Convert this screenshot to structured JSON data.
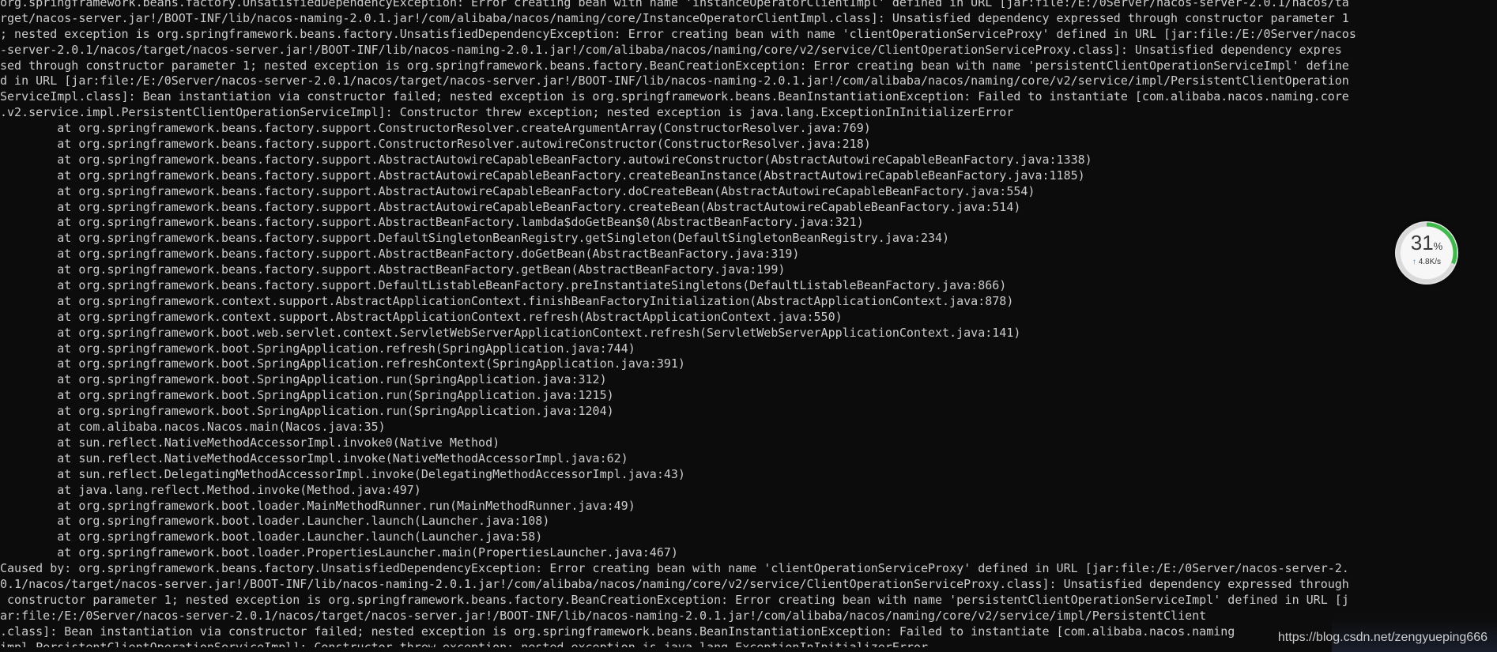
{
  "console": {
    "lines": [
      "org.springframework.beans.factory.UnsatisfiedDependencyException: Error creating bean with name 'instanceOperatorClientImpl' defined in URL [jar:file:/E:/0Server/nacos-server-2.0.1/nacos/ta",
      "rget/nacos-server.jar!/BOOT-INF/lib/nacos-naming-2.0.1.jar!/com/alibaba/nacos/naming/core/InstanceOperatorClientImpl.class]: Unsatisfied dependency expressed through constructor parameter 1",
      "; nested exception is org.springframework.beans.factory.UnsatisfiedDependencyException: Error creating bean with name 'clientOperationServiceProxy' defined in URL [jar:file:/E:/0Server/nacos",
      "-server-2.0.1/nacos/target/nacos-server.jar!/BOOT-INF/lib/nacos-naming-2.0.1.jar!/com/alibaba/nacos/naming/core/v2/service/ClientOperationServiceProxy.class]: Unsatisfied dependency expres",
      "sed through constructor parameter 1; nested exception is org.springframework.beans.factory.BeanCreationException: Error creating bean with name 'persistentClientOperationServiceImpl' define",
      "d in URL [jar:file:/E:/0Server/nacos-server-2.0.1/nacos/target/nacos-server.jar!/BOOT-INF/lib/nacos-naming-2.0.1.jar!/com/alibaba/nacos/naming/core/v2/service/impl/PersistentClientOperation",
      "ServiceImpl.class]: Bean instantiation via constructor failed; nested exception is org.springframework.beans.BeanInstantiationException: Failed to instantiate [com.alibaba.nacos.naming.core",
      ".v2.service.impl.PersistentClientOperationServiceImpl]: Constructor threw exception; nested exception is java.lang.ExceptionInInitializerError",
      "        at org.springframework.beans.factory.support.ConstructorResolver.createArgumentArray(ConstructorResolver.java:769)",
      "        at org.springframework.beans.factory.support.ConstructorResolver.autowireConstructor(ConstructorResolver.java:218)",
      "        at org.springframework.beans.factory.support.AbstractAutowireCapableBeanFactory.autowireConstructor(AbstractAutowireCapableBeanFactory.java:1338)",
      "        at org.springframework.beans.factory.support.AbstractAutowireCapableBeanFactory.createBeanInstance(AbstractAutowireCapableBeanFactory.java:1185)",
      "        at org.springframework.beans.factory.support.AbstractAutowireCapableBeanFactory.doCreateBean(AbstractAutowireCapableBeanFactory.java:554)",
      "        at org.springframework.beans.factory.support.AbstractAutowireCapableBeanFactory.createBean(AbstractAutowireCapableBeanFactory.java:514)",
      "        at org.springframework.beans.factory.support.AbstractBeanFactory.lambda$doGetBean$0(AbstractBeanFactory.java:321)",
      "        at org.springframework.beans.factory.support.DefaultSingletonBeanRegistry.getSingleton(DefaultSingletonBeanRegistry.java:234)",
      "        at org.springframework.beans.factory.support.AbstractBeanFactory.doGetBean(AbstractBeanFactory.java:319)",
      "        at org.springframework.beans.factory.support.AbstractBeanFactory.getBean(AbstractBeanFactory.java:199)",
      "        at org.springframework.beans.factory.support.DefaultListableBeanFactory.preInstantiateSingletons(DefaultListableBeanFactory.java:866)",
      "        at org.springframework.context.support.AbstractApplicationContext.finishBeanFactoryInitialization(AbstractApplicationContext.java:878)",
      "        at org.springframework.context.support.AbstractApplicationContext.refresh(AbstractApplicationContext.java:550)",
      "        at org.springframework.boot.web.servlet.context.ServletWebServerApplicationContext.refresh(ServletWebServerApplicationContext.java:141)",
      "        at org.springframework.boot.SpringApplication.refresh(SpringApplication.java:744)",
      "        at org.springframework.boot.SpringApplication.refreshContext(SpringApplication.java:391)",
      "        at org.springframework.boot.SpringApplication.run(SpringApplication.java:312)",
      "        at org.springframework.boot.SpringApplication.run(SpringApplication.java:1215)",
      "        at org.springframework.boot.SpringApplication.run(SpringApplication.java:1204)",
      "        at com.alibaba.nacos.Nacos.main(Nacos.java:35)",
      "        at sun.reflect.NativeMethodAccessorImpl.invoke0(Native Method)",
      "        at sun.reflect.NativeMethodAccessorImpl.invoke(NativeMethodAccessorImpl.java:62)",
      "        at sun.reflect.DelegatingMethodAccessorImpl.invoke(DelegatingMethodAccessorImpl.java:43)",
      "        at java.lang.reflect.Method.invoke(Method.java:497)",
      "        at org.springframework.boot.loader.MainMethodRunner.run(MainMethodRunner.java:49)",
      "        at org.springframework.boot.loader.Launcher.launch(Launcher.java:108)",
      "        at org.springframework.boot.loader.Launcher.launch(Launcher.java:58)",
      "        at org.springframework.boot.loader.PropertiesLauncher.main(PropertiesLauncher.java:467)",
      "Caused by: org.springframework.beans.factory.UnsatisfiedDependencyException: Error creating bean with name 'clientOperationServiceProxy' defined in URL [jar:file:/E:/0Server/nacos-server-2.",
      "0.1/nacos/target/nacos-server.jar!/BOOT-INF/lib/nacos-naming-2.0.1.jar!/com/alibaba/nacos/naming/core/v2/service/ClientOperationServiceProxy.class]: Unsatisfied dependency expressed through",
      " constructor parameter 1; nested exception is org.springframework.beans.factory.BeanCreationException: Error creating bean with name 'persistentClientOperationServiceImpl' defined in URL [j",
      "ar:file:/E:/0Server/nacos-server-2.0.1/nacos/target/nacos-server.jar!/BOOT-INF/lib/nacos-naming-2.0.1.jar!/com/alibaba/nacos/naming/core/v2/service/impl/PersistentClient",
      ".class]: Bean instantiation via constructor failed; nested exception is org.springframework.beans.BeanInstantiationException: Failed to instantiate [com.alibaba.nacos.naming",
      "impl.PersistentClientOperationServiceImpl]: Constructor threw exception; nested exception is java.lang.ExceptionInInitializerError"
    ]
  },
  "net_widget": {
    "percent": "31",
    "percent_unit": "%",
    "percent_value": 0.31,
    "speed": "4.8K/s",
    "ring_color": "#3dbb4a",
    "arrow_color": "#1e90ff"
  },
  "watermark": {
    "text": "https://blog.csdn.net/zengyueping666"
  },
  "colors": {
    "background": "#0c0c0c",
    "text": "#cccccc"
  }
}
